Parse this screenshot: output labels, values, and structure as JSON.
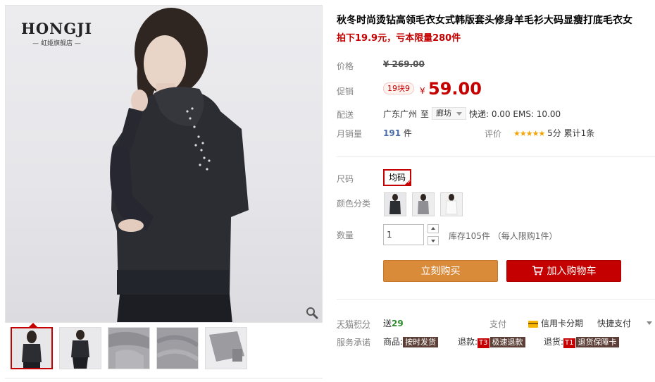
{
  "brand": {
    "name": "HONGJI",
    "subtitle": "— 虹姬旗舰店 —"
  },
  "gallery": {
    "thumbnails": [
      "model-front",
      "model-back",
      "collar-detail",
      "fabric-detail",
      "sleeve-detail"
    ],
    "selected_index": 0
  },
  "product": {
    "title": "秋冬时尚烫钻高领毛衣女式韩版套头修身羊毛衫大码显瘦打底毛衣女",
    "subtitle": "拍下19.9元，亏本限量280件"
  },
  "price": {
    "label": "价格",
    "original": "¥ 269.00",
    "promo_label": "促销",
    "promo_tag": "19块9",
    "currency": "¥",
    "current": "59.00"
  },
  "shipping": {
    "label": "配送",
    "from": "广东广州",
    "to_word": "至",
    "destination": "廊坊",
    "fees": "快递: 0.00 EMS: 10.00"
  },
  "sales": {
    "label": "月销量",
    "count": "191",
    "unit": "件",
    "rating_label": "评价",
    "stars": "★★★★★",
    "score": "5分",
    "reviews": "累计1条"
  },
  "size": {
    "label": "尺码",
    "option": "均码"
  },
  "color": {
    "label": "颜色分类",
    "options": [
      "dark-grey",
      "grey",
      "white"
    ]
  },
  "quantity": {
    "label": "数量",
    "value": "1",
    "stock": "库存105件 （每人限购1件）"
  },
  "buttons": {
    "buy": "立刻购买",
    "cart": "加入购物车"
  },
  "points": {
    "label": "天猫积分",
    "text": "送",
    "value": "29"
  },
  "payment": {
    "label": "支付",
    "credit": "信用卡分期",
    "quick": "快捷支付"
  },
  "service": {
    "label": "服务承诺",
    "goods_prefix": "商品:",
    "goods_tag": "按时发货",
    "refund_prefix": "退款:",
    "refund_badge": "T3",
    "refund_tag": "极速退款",
    "return_prefix": "退货:",
    "return_badge": "T1",
    "return_tag": "退货保障卡"
  },
  "colors": {
    "accent": "#c40000",
    "buy": "#d98b3a",
    "label": "#838383"
  }
}
